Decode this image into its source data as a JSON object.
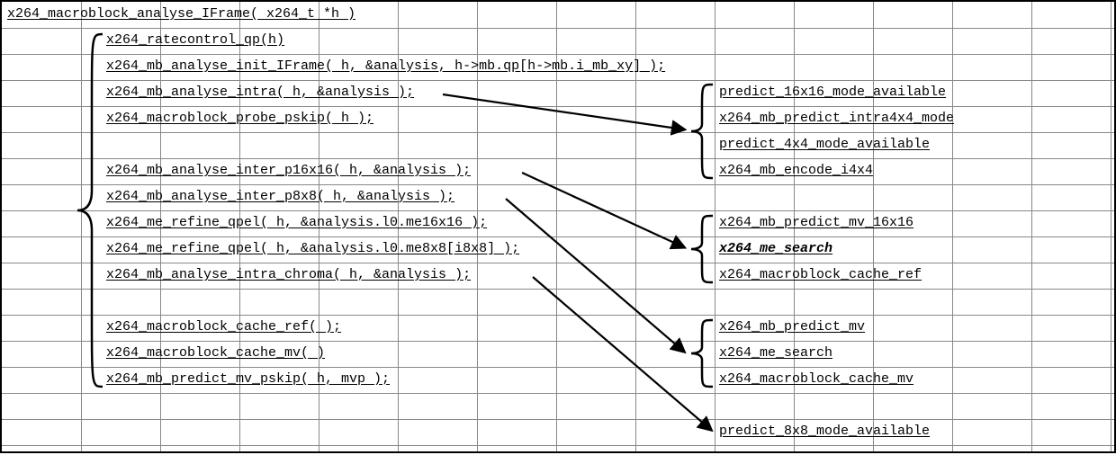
{
  "header": "x264_macroblock_analyse_IFrame( x264_t *h )",
  "left": {
    "l0": "x264_ratecontrol_qp(h)",
    "l1": "x264_mb_analyse_init_IFrame( h, &analysis, h->mb.qp[h->mb.i_mb_xy] );",
    "l2": "x264_mb_analyse_intra( h, &analysis );",
    "l3": "x264_macroblock_probe_pskip( h );",
    "l4": "x264_mb_analyse_inter_p16x16( h, &analysis );",
    "l5": "x264_mb_analyse_inter_p8x8( h, &analysis );",
    "l6": "x264_me_refine_qpel( h, &analysis.l0.me16x16 );",
    "l7": "x264_me_refine_qpel( h, &analysis.l0.me8x8[i8x8] );",
    "l8": "x264_mb_analyse_intra_chroma( h, &analysis );",
    "l9": "x264_macroblock_cache_ref(  );",
    "l10": "x264_macroblock_cache_mv(  )",
    "l11": "x264_mb_predict_mv_pskip( h, mvp );"
  },
  "groupA": {
    "a0": "predict_16x16_mode_available",
    "a1": "x264_mb_predict_intra4x4_mode",
    "a2": "predict_4x4_mode_available",
    "a3": "x264_mb_encode_i4x4"
  },
  "groupB": {
    "b0": "x264_mb_predict_mv_16x16",
    "b1": "x264_me_search",
    "b2": "x264_macroblock_cache_ref"
  },
  "groupC": {
    "c0": "x264_mb_predict_mv",
    "c1": "x264_me_search",
    "c2": "x264_macroblock_cache_mv"
  },
  "tail": "predict_8x8_mode_available"
}
